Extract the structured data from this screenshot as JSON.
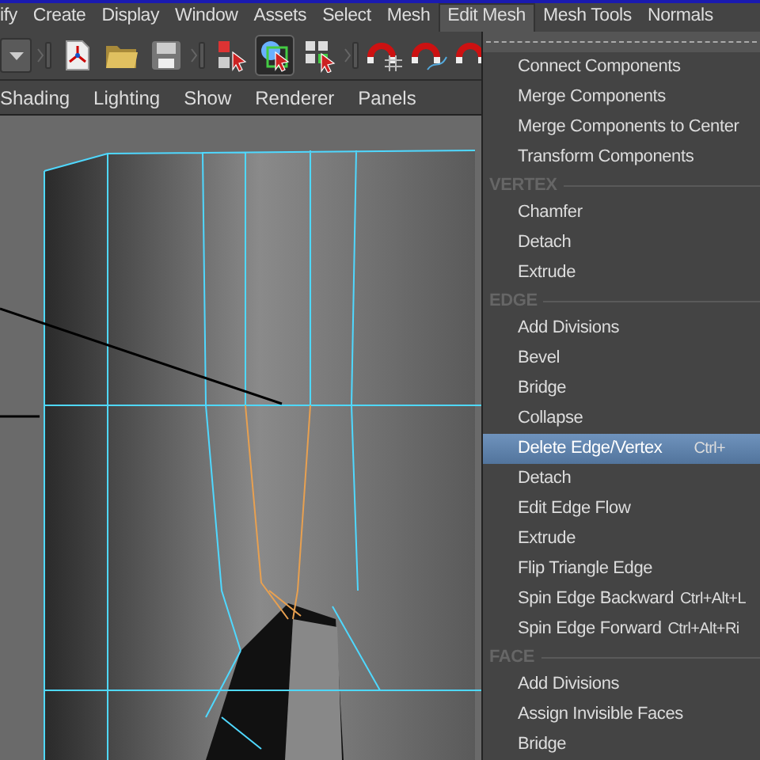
{
  "menu_bar": [
    {
      "label": "ify",
      "selected": false
    },
    {
      "label": "Create",
      "selected": false
    },
    {
      "label": "Display",
      "selected": false
    },
    {
      "label": "Window",
      "selected": false
    },
    {
      "label": "Assets",
      "selected": false
    },
    {
      "label": "Select",
      "selected": false
    },
    {
      "label": "Mesh",
      "selected": false
    },
    {
      "label": "Edit Mesh",
      "selected": true
    },
    {
      "label": "Mesh Tools",
      "selected": false
    },
    {
      "label": "Normals",
      "selected": false
    }
  ],
  "toolbar": [
    {
      "kind": "dropdown",
      "selected": false
    },
    {
      "kind": "sep"
    },
    {
      "kind": "new-scene",
      "selected": false
    },
    {
      "kind": "folder",
      "selected": false
    },
    {
      "kind": "save",
      "selected": false
    },
    {
      "kind": "sep"
    },
    {
      "kind": "select-hierarchy",
      "selected": false
    },
    {
      "kind": "select-object",
      "selected": true
    },
    {
      "kind": "select-component",
      "selected": false
    },
    {
      "kind": "sep"
    },
    {
      "kind": "snap-grid",
      "selected": false
    },
    {
      "kind": "snap-curve",
      "selected": false
    },
    {
      "kind": "snap-point",
      "selected": false
    }
  ],
  "panel_menu": [
    "Shading",
    "Lighting",
    "Show",
    "Renderer",
    "Panels"
  ],
  "dropdown": [
    {
      "kind": "item",
      "label": "Connect Components",
      "selected": false
    },
    {
      "kind": "item",
      "label": "Merge Components",
      "selected": false
    },
    {
      "kind": "item",
      "label": "Merge Components to Center",
      "selected": false
    },
    {
      "kind": "item",
      "label": "Transform Components",
      "selected": false
    },
    {
      "kind": "header",
      "label": "VERTEX"
    },
    {
      "kind": "item",
      "label": "Chamfer",
      "selected": false
    },
    {
      "kind": "item",
      "label": "Detach",
      "selected": false
    },
    {
      "kind": "item",
      "label": "Extrude",
      "selected": false
    },
    {
      "kind": "header",
      "label": "EDGE"
    },
    {
      "kind": "item",
      "label": "Add Divisions",
      "selected": false
    },
    {
      "kind": "item",
      "label": "Bevel",
      "selected": false
    },
    {
      "kind": "item",
      "label": "Bridge",
      "selected": false
    },
    {
      "kind": "item",
      "label": "Collapse",
      "selected": false
    },
    {
      "kind": "item",
      "label": "Delete Edge/Vertex",
      "shortcut": "Ctrl+",
      "selected": true
    },
    {
      "kind": "item",
      "label": "Detach",
      "selected": false
    },
    {
      "kind": "item",
      "label": "Edit Edge Flow",
      "selected": false
    },
    {
      "kind": "item",
      "label": "Extrude",
      "selected": false
    },
    {
      "kind": "item",
      "label": "Flip Triangle Edge",
      "selected": false
    },
    {
      "kind": "item",
      "label": "Spin Edge Backward",
      "shortcut": "Ctrl+Alt+L",
      "selected": false
    },
    {
      "kind": "item",
      "label": "Spin Edge Forward",
      "shortcut": "Ctrl+Alt+Ri",
      "selected": false
    },
    {
      "kind": "header",
      "label": "FACE"
    },
    {
      "kind": "item",
      "label": "Add Divisions",
      "selected": false
    },
    {
      "kind": "item",
      "label": "Assign Invisible Faces",
      "selected": false
    },
    {
      "kind": "item",
      "label": "Bridge",
      "selected": false
    }
  ]
}
